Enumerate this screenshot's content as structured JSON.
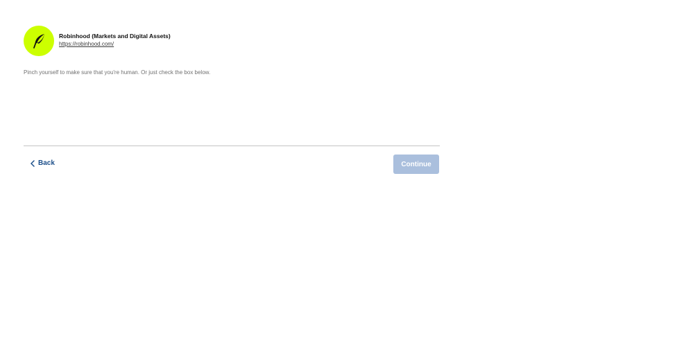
{
  "header": {
    "logo_icon": "robinhood-feather-icon",
    "logo_color": "#ccff00",
    "org_name": "Robinhood (Markets and Digital Assets)",
    "org_url": "https://robinhood.com/"
  },
  "main": {
    "instruction": "Pinch yourself to make sure that you're human. Or just check the box below."
  },
  "footer": {
    "back_label": "Back",
    "back_icon": "chevron-left-icon",
    "continue_label": "Continue",
    "continue_color": "#aabfdd",
    "accent_color": "#1c4f8a"
  }
}
